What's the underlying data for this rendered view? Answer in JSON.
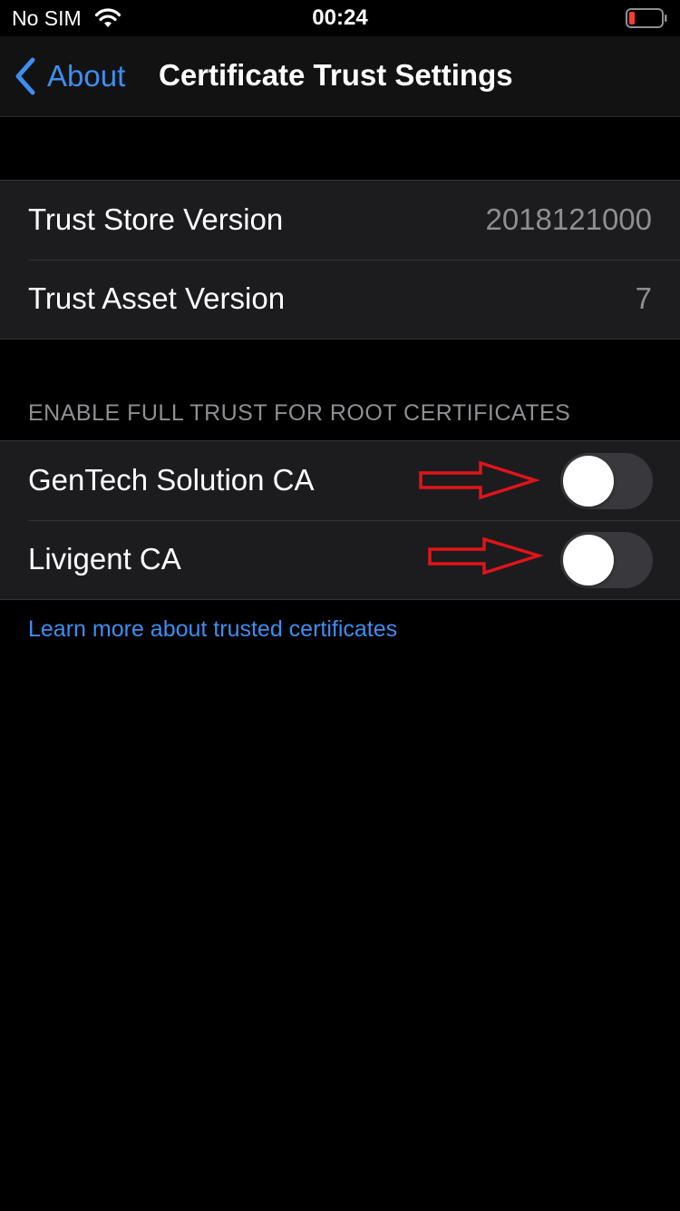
{
  "status_bar": {
    "carrier": "No SIM",
    "time": "00:24",
    "wifi_icon": "wifi-icon",
    "battery_icon": "battery-low-icon",
    "battery_color": "#ff3b30"
  },
  "nav": {
    "back_label": "About",
    "title": "Certificate Trust Settings"
  },
  "versions": [
    {
      "label": "Trust Store Version",
      "value": "2018121000"
    },
    {
      "label": "Trust Asset Version",
      "value": "7"
    }
  ],
  "trust_section": {
    "header": "ENABLE FULL TRUST FOR ROOT CERTIFICATES",
    "certificates": [
      {
        "label": "GenTech Solution CA",
        "enabled": false
      },
      {
        "label": "Livigent CA",
        "enabled": false
      }
    ]
  },
  "learn_more_link": "Learn more about trusted certificates",
  "annotation_color": "#e0141a",
  "accent_color": "#3d8ef0"
}
